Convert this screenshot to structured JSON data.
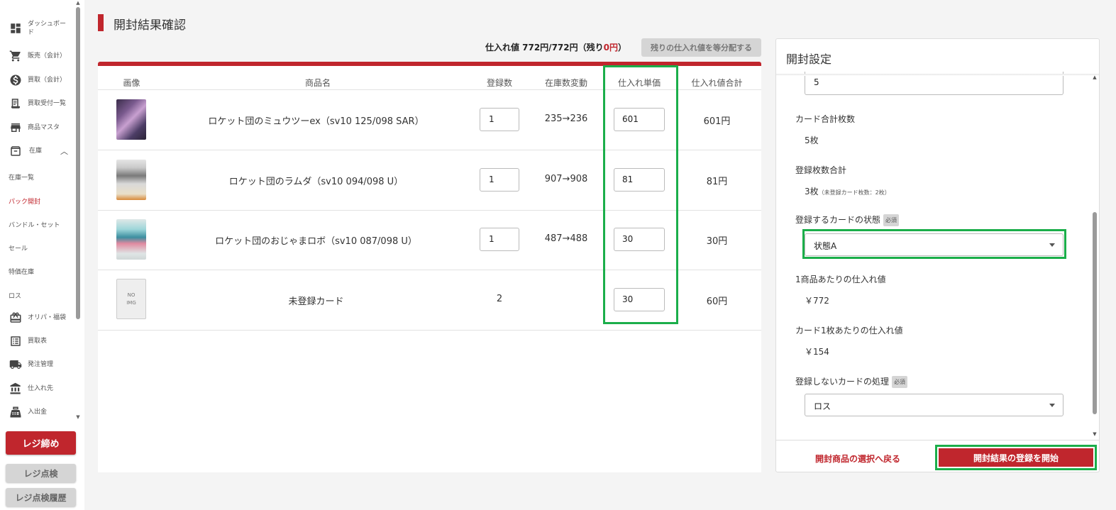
{
  "sidebar": {
    "items": [
      {
        "label": "ダッシュボード",
        "icon": "dashboard-icon"
      },
      {
        "label": "販売（会計）",
        "icon": "cart-icon"
      },
      {
        "label": "買取（会計）",
        "icon": "dollar-icon"
      },
      {
        "label": "買取受付一覧",
        "icon": "receipt-icon"
      },
      {
        "label": "商品マスタ",
        "icon": "store-icon"
      },
      {
        "label": "在庫",
        "icon": "archive-icon"
      }
    ],
    "sub_items": [
      "在庫一覧",
      "パック開封",
      "バンドル・セット",
      "セール",
      "特価在庫",
      "ロス"
    ],
    "items2": [
      {
        "label": "オリパ・福袋",
        "icon": "gift-icon"
      },
      {
        "label": "買取表",
        "icon": "list-icon"
      },
      {
        "label": "発注管理",
        "icon": "truck-icon"
      },
      {
        "label": "仕入れ先",
        "icon": "bank-icon"
      },
      {
        "label": "入出金",
        "icon": "register-icon"
      }
    ],
    "close_button": "レジ締め",
    "check_button": "レジ点検",
    "history_button": "レジ点検履歴"
  },
  "page": {
    "title": "開封結果確認"
  },
  "summary": {
    "prefix": "仕入れ値 772円/772円（残り",
    "remain": "0円",
    "suffix": "）"
  },
  "distribute_button": "残りの仕入れ値を等分配する",
  "table": {
    "headers": [
      "画像",
      "商品名",
      "登録数",
      "在庫数変動",
      "仕入れ単価",
      "仕入れ値合計"
    ],
    "rows": [
      {
        "name": "ロケット団のミュウツーex（sv10 125/098 SAR）",
        "count": "1",
        "stock": "235→236",
        "price": "601",
        "total": "601円"
      },
      {
        "name": "ロケット団のラムダ（sv10 094/098 U）",
        "count": "1",
        "stock": "907→908",
        "price": "81",
        "total": "81円"
      },
      {
        "name": "ロケット団のおじゃまロボ（sv10 087/098 U）",
        "count": "1",
        "stock": "487→488",
        "price": "30",
        "total": "30円"
      },
      {
        "name": "未登録カード",
        "count": "2",
        "stock": "",
        "price": "30",
        "total": "60円",
        "noimg": "NO IMG"
      }
    ]
  },
  "panel": {
    "title": "開封設定",
    "top_input_value": "5",
    "card_total_label": "カード合計枚数",
    "card_total_value": "5枚",
    "registered_label": "登録枚数合計",
    "registered_value": "3枚",
    "registered_note": "（未登録カード枚数：2枚）",
    "condition_label": "登録するカードの状態",
    "required": "必須",
    "condition_value": "状態A",
    "per_product_label": "1商品あたりの仕入れ値",
    "per_product_value": "￥772",
    "per_card_label": "カード1枚あたりの仕入れ値",
    "per_card_value": "￥154",
    "unregistered_label": "登録しないカードの処理",
    "unregistered_value": "ロス",
    "back_button": "開封商品の選択へ戻る",
    "start_button": "開封結果の登録を開始"
  },
  "colors": {
    "accent": "#c0262d",
    "highlight": "#1bae4a"
  }
}
